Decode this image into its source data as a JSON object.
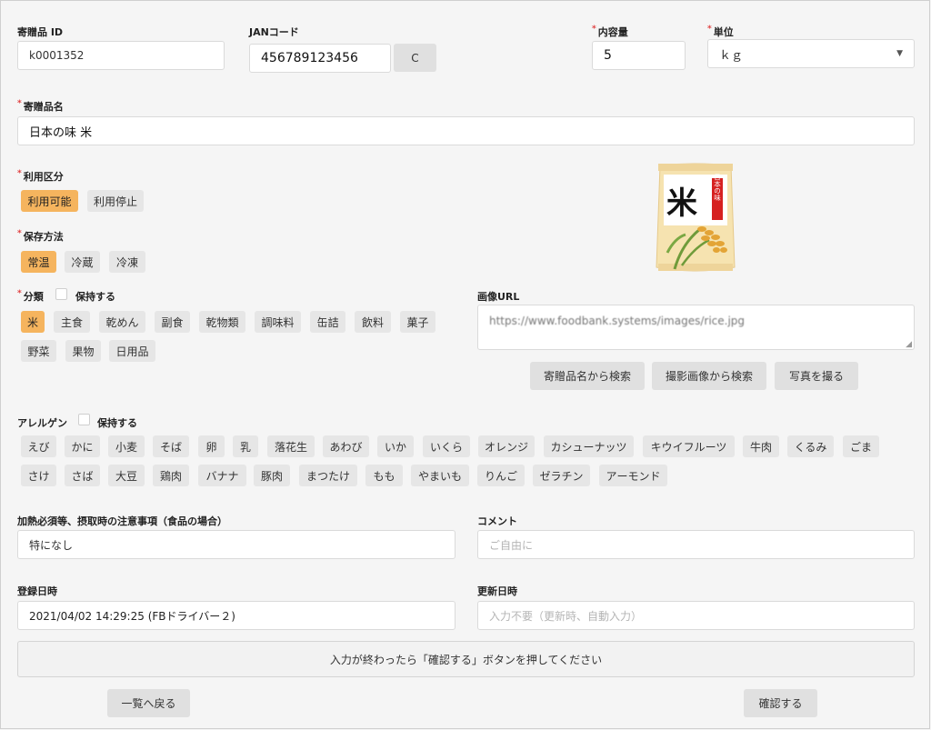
{
  "fields": {
    "id_label": "寄贈品 ID",
    "id_value": "k0001352",
    "jan_label": "JANコード",
    "jan_value": "456789123456",
    "jan_clear": "C",
    "volume_label": "内容量",
    "volume_value": "5",
    "unit_label": "単位",
    "unit_value": "ｋｇ",
    "name_label": "寄贈品名",
    "name_value": "日本の味 米"
  },
  "usage": {
    "label": "利用区分",
    "options": [
      "利用可能",
      "利用停止"
    ],
    "selected": "利用可能"
  },
  "storage": {
    "label": "保存方法",
    "options": [
      "常温",
      "冷蔵",
      "冷凍"
    ],
    "selected": "常温"
  },
  "category": {
    "label": "分類",
    "hold_label": "保持する",
    "row1": [
      "米",
      "主食",
      "乾めん",
      "副食",
      "乾物類",
      "調味料",
      "缶詰",
      "飲料",
      "菓子"
    ],
    "row2": [
      "野菜",
      "果物",
      "日用品"
    ],
    "selected": "米"
  },
  "image": {
    "bag_char": "米",
    "bag_side_text": "日本の味",
    "url_label": "画像URL",
    "url_value": "https://www.foodbank.systems/images/rice.jpg",
    "btn_search_name": "寄贈品名から検索",
    "btn_search_photo": "撮影画像から検索",
    "btn_take_photo": "写真を撮る"
  },
  "allergen": {
    "label": "アレルゲン",
    "hold_label": "保持する",
    "row1": [
      "えび",
      "かに",
      "小麦",
      "そば",
      "卵",
      "乳",
      "落花生",
      "あわび",
      "いか",
      "いくら",
      "オレンジ",
      "カシューナッツ",
      "キウイフルーツ",
      "牛肉",
      "くるみ",
      "ごま"
    ],
    "row2": [
      "さけ",
      "さば",
      "大豆",
      "鶏肉",
      "バナナ",
      "豚肉",
      "まつたけ",
      "もも",
      "やまいも",
      "りんご",
      "ゼラチン",
      "アーモンド"
    ]
  },
  "notes": {
    "caution_label": "加熱必須等、摂取時の注意事項（食品の場合）",
    "caution_value": "特になし",
    "comment_label": "コメント",
    "comment_placeholder": "ご自由に"
  },
  "dates": {
    "created_label": "登録日時",
    "created_value": "2021/04/02 14:29:25 (FBドライバー２)",
    "updated_label": "更新日時",
    "updated_placeholder": "入力不要（更新時、自動入力）"
  },
  "footer": {
    "notice": "入力が終わったら「確認する」ボタンを押してください",
    "back": "一覧へ戻る",
    "confirm": "確認する"
  },
  "colors": {
    "selected_chip": "#f5b45e",
    "chip": "#e6e6e6",
    "required": "#e04040"
  }
}
